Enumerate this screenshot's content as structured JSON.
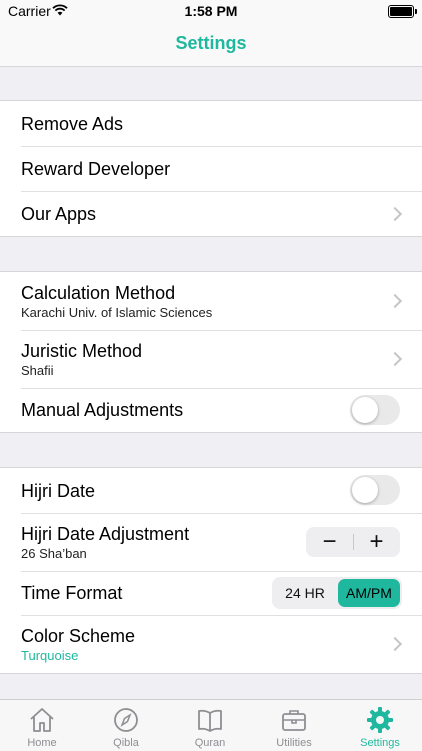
{
  "status_bar": {
    "carrier": "Carrier",
    "time": "1:58 PM"
  },
  "nav": {
    "title": "Settings"
  },
  "section1": {
    "remove_ads": "Remove Ads",
    "reward_developer": "Reward Developer",
    "our_apps": "Our Apps"
  },
  "section2": {
    "calculation_method": {
      "label": "Calculation Method",
      "value": "Karachi Univ. of Islamic Sciences"
    },
    "juristic_method": {
      "label": "Juristic Method",
      "value": "Shafii"
    },
    "manual_adjustments": {
      "label": "Manual Adjustments",
      "on": false
    }
  },
  "section3": {
    "hijri_date": {
      "label": "Hijri Date",
      "on": false
    },
    "hijri_adjustment": {
      "label": "Hijri Date Adjustment",
      "value": "26 Sha’ban",
      "minus": "−",
      "plus": "+"
    },
    "time_format": {
      "label": "Time Format",
      "options": [
        "24 HR",
        "AM/PM"
      ],
      "selected": "AM/PM"
    },
    "color_scheme": {
      "label": "Color Scheme",
      "value": "Turquoise"
    }
  },
  "tabs": [
    {
      "label": "Home",
      "icon": "house-icon"
    },
    {
      "label": "Qibla",
      "icon": "compass-icon"
    },
    {
      "label": "Quran",
      "icon": "book-icon"
    },
    {
      "label": "Utilities",
      "icon": "briefcase-icon"
    },
    {
      "label": "Settings",
      "icon": "gear-icon",
      "active": true
    }
  ],
  "colors": {
    "accent": "#1fb89f",
    "background": "#efeff4",
    "inactive": "#8e8e93"
  }
}
